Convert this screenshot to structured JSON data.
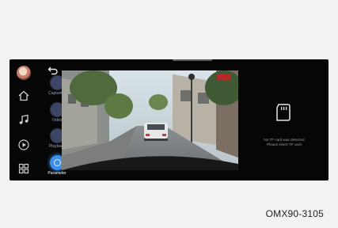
{
  "modes": [
    {
      "label": "Capturing",
      "active": false
    },
    {
      "label": "Video",
      "active": false
    },
    {
      "label": "Playback",
      "active": false
    },
    {
      "label": "Parameter",
      "active": true
    }
  ],
  "nav_icons": [
    "home-icon",
    "music-icon",
    "play-icon",
    "apps-icon"
  ],
  "status": {
    "line1": "No TF card was detected",
    "line2": "Please insert TF card"
  },
  "caption": "OMX90-3105",
  "colors": {
    "accent": "#3b8fe8",
    "frame_bg": "#060606",
    "page_bg": "#f2f2f2"
  }
}
